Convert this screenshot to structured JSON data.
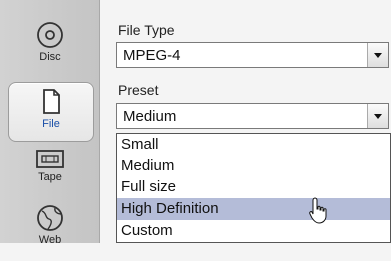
{
  "sidebar": {
    "items": [
      {
        "label": "Disc",
        "icon": "disc-icon"
      },
      {
        "label": "File",
        "icon": "file-icon",
        "active": true
      },
      {
        "label": "Tape",
        "icon": "tape-icon"
      },
      {
        "label": "Web",
        "icon": "web-globe-icon"
      }
    ]
  },
  "file_type": {
    "label": "File Type",
    "value": "MPEG-4"
  },
  "preset": {
    "label": "Preset",
    "value": "Medium",
    "options": [
      "Small",
      "Medium",
      "Full size",
      "High Definition",
      "Custom"
    ],
    "highlighted": "High Definition"
  },
  "colors": {
    "highlight": "#b4bcd8",
    "active_label": "#1a4fa8"
  }
}
